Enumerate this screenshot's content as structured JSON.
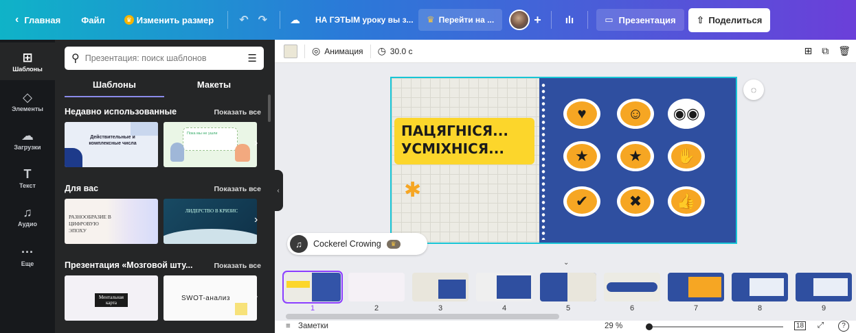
{
  "topbar": {
    "home": "Главная",
    "file": "Файл",
    "resize": "Изменить размер",
    "title": "НА ГЭТЫМ уроку вы з...",
    "upgrade": "Перейти на ...",
    "present": "Презентация",
    "share": "Поделиться"
  },
  "rail": [
    {
      "label": "Шаблоны",
      "icon": "⊞"
    },
    {
      "label": "Элементы",
      "icon": "◇"
    },
    {
      "label": "Загрузки",
      "icon": "☁"
    },
    {
      "label": "Текст",
      "icon": "T"
    },
    {
      "label": "Аудио",
      "icon": "♫"
    },
    {
      "label": "Еще",
      "icon": "···"
    }
  ],
  "panel": {
    "search_placeholder": "Презентация: поиск шаблонов",
    "tabs": [
      "Шаблоны",
      "Макеты"
    ],
    "sections": [
      {
        "title": "Недавно использованные",
        "more": "Показать все",
        "thumbs": [
          "Действительные и комплексные числа",
          "Пока мы не ушли"
        ]
      },
      {
        "title": "Для вас",
        "more": "Показать все",
        "thumbs": [
          "РАЗНООБРАЗИЕ В ЦИФРОВУЮ ЭПОХУ",
          "ЛИДЕРСТВО В КРИЗИС"
        ]
      },
      {
        "title": "Презентация «Мозговой шту...",
        "more": "Показать все",
        "thumbs": [
          "Ментальная карта",
          "SWOT-анализ"
        ]
      }
    ]
  },
  "editor": {
    "animation": "Анимация",
    "duration": "30.0 с"
  },
  "slide": {
    "headline_1": "ПАЦЯГНІСЯ...",
    "headline_2": "УСМІХНІСЯ..."
  },
  "audio": {
    "track": "Cockerel Crowing"
  },
  "pages": [
    "1",
    "2",
    "3",
    "4",
    "5",
    "6",
    "7",
    "8",
    "9"
  ],
  "bottom": {
    "notes": "Заметки",
    "zoom": "29 %",
    "page_count": "18"
  }
}
